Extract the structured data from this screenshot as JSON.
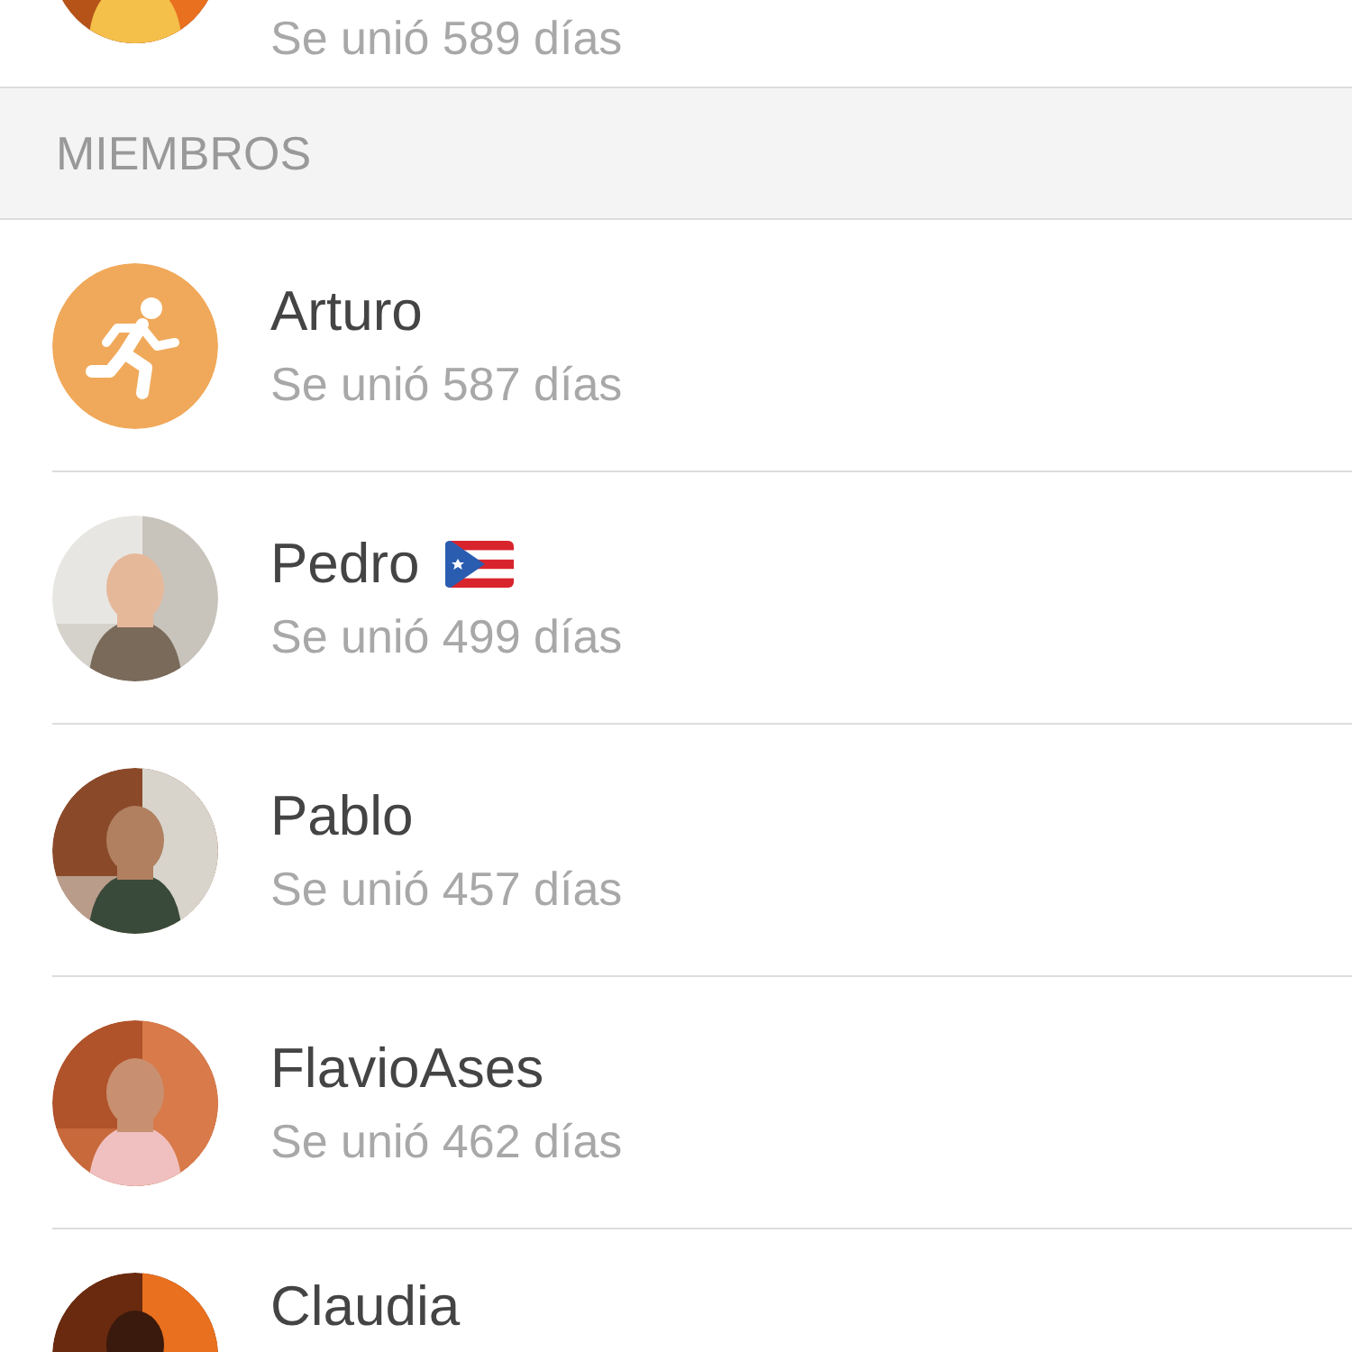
{
  "top_member": {
    "subtitle": "Se unió 589 días"
  },
  "section": {
    "title": "MIEMBROS"
  },
  "members": [
    {
      "name": "Arturo",
      "subtitle": "Se unió 587 días",
      "avatar": {
        "kind": "runner",
        "color": "#f0a95a"
      },
      "has_flag": false
    },
    {
      "name": "Pedro",
      "subtitle": "Se unió 499 días",
      "has_flag": true
    },
    {
      "name": "Pablo",
      "subtitle": "Se unió 457 días",
      "has_flag": false
    },
    {
      "name": "FlavioAses",
      "subtitle": "Se unió 462 días",
      "has_flag": false
    },
    {
      "name": "Claudia",
      "has_flag": false
    }
  ]
}
